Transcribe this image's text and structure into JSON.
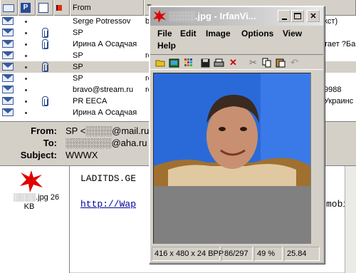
{
  "list": {
    "columns": {
      "from": "From",
      "t": "T"
    },
    "rows": [
      {
        "from": "Serge Potressov",
        "subj": "b",
        "right": "кст)",
        "clip": false,
        "sel": false
      },
      {
        "from": "SP",
        "subj": "",
        "right": "",
        "clip": true,
        "sel": false
      },
      {
        "from": "Ирина А Осадчая",
        "subj": "",
        "right": "тает ?Ба",
        "clip": true,
        "sel": false
      },
      {
        "from": "SP",
        "subj": "re",
        "right": "",
        "clip": false,
        "sel": false
      },
      {
        "from": "SP",
        "subj": "",
        "right": "",
        "clip": true,
        "sel": true
      },
      {
        "from": "SP",
        "subj": "re",
        "right": "",
        "clip": false,
        "sel": false
      },
      {
        "from": "bravo@stream.ru",
        "subj": "re",
        "right": "9988",
        "clip": false,
        "sel": false
      },
      {
        "from": "PR EECA",
        "subj": "",
        "right": "Украинс",
        "clip": true,
        "sel": false
      },
      {
        "from": "Ирина А Осадчая",
        "subj": "",
        "right": "",
        "clip": false,
        "sel": false
      }
    ]
  },
  "header": {
    "from_label": "From:",
    "from_value": "SP <░░░░@mail.ru>",
    "to_label": "To:",
    "to_value": "░░░░░░░@aha.ru",
    "subject_label": "Subject:",
    "subject_value": "WWWX"
  },
  "attachment": {
    "name": "░░░░.jpg 26",
    "size": "KB"
  },
  "preview": {
    "line1": "LADITDS.GE",
    "link": "http://Wap",
    "link_tail": "mobil"
  },
  "irfan": {
    "title": "░░░░.jpg - IrfanVi...",
    "menu": [
      "File",
      "Edit",
      "Image",
      "Options",
      "View",
      "Help"
    ],
    "status": {
      "dims": "416 x 480 x 24 BPP",
      "pos": "86/297",
      "zoom": "49 %",
      "extra": "25.84"
    }
  }
}
